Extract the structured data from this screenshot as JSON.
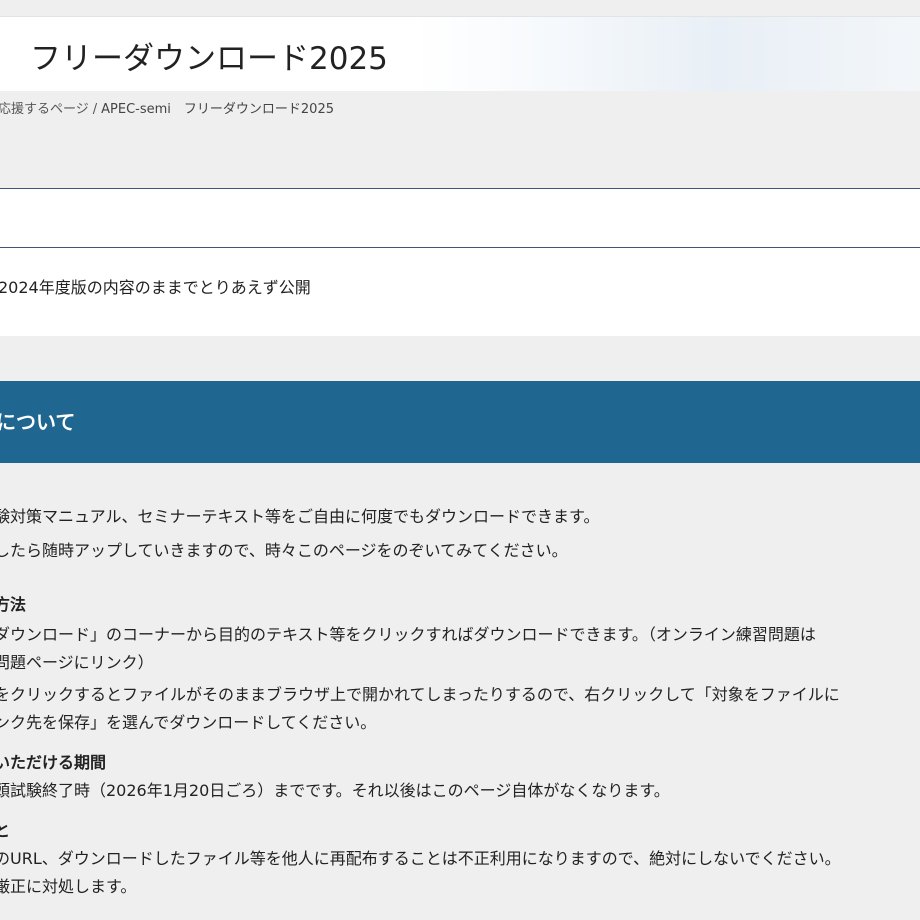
{
  "page": {
    "title": "フリーダウンロード2025"
  },
  "breadcrumb": {
    "items": [
      "応援するページ",
      "APEC-semi　フリーダウンロード2025"
    ],
    "separator": "/"
  },
  "notice": {
    "text": "2024年度版の内容のままでとりあえず公開"
  },
  "section": {
    "title": "について",
    "intro": [
      "験対策マニュアル、セミナーテキスト等をご自由に何度でもダウンロードできます。",
      "したら随時アップしていきますので、時々このページをのぞいてみてください。"
    ],
    "method": {
      "heading": "方法",
      "lines": [
        "ダウンロード」のコーナーから目的のテキスト等をクリックすればダウンロードできます。（オンライン練習問題は",
        "問題ページにリンク）",
        "をクリックするとファイルがそのままブラウザ上で開かれてしまったりするので、右クリックして「対象をファイルに",
        "ンク先を保存」を選んでダウンロードしてください。"
      ]
    },
    "period": {
      "heading": "いただける期間",
      "lines": [
        "頭試験終了時（2026年1月20日ごろ）までです。それ以後はこのページ自体がなくなります。"
      ]
    },
    "caution": {
      "heading": "と",
      "lines": [
        "のURL、ダウンロードしたファイル等を他人に再配布することは不正利用になりますので、絶対にしないでください。",
        "厳正に対処します。"
      ]
    }
  },
  "colors": {
    "section_header_bg": "#1f6690",
    "rule": "#3f557a",
    "page_bg": "#efefef"
  }
}
